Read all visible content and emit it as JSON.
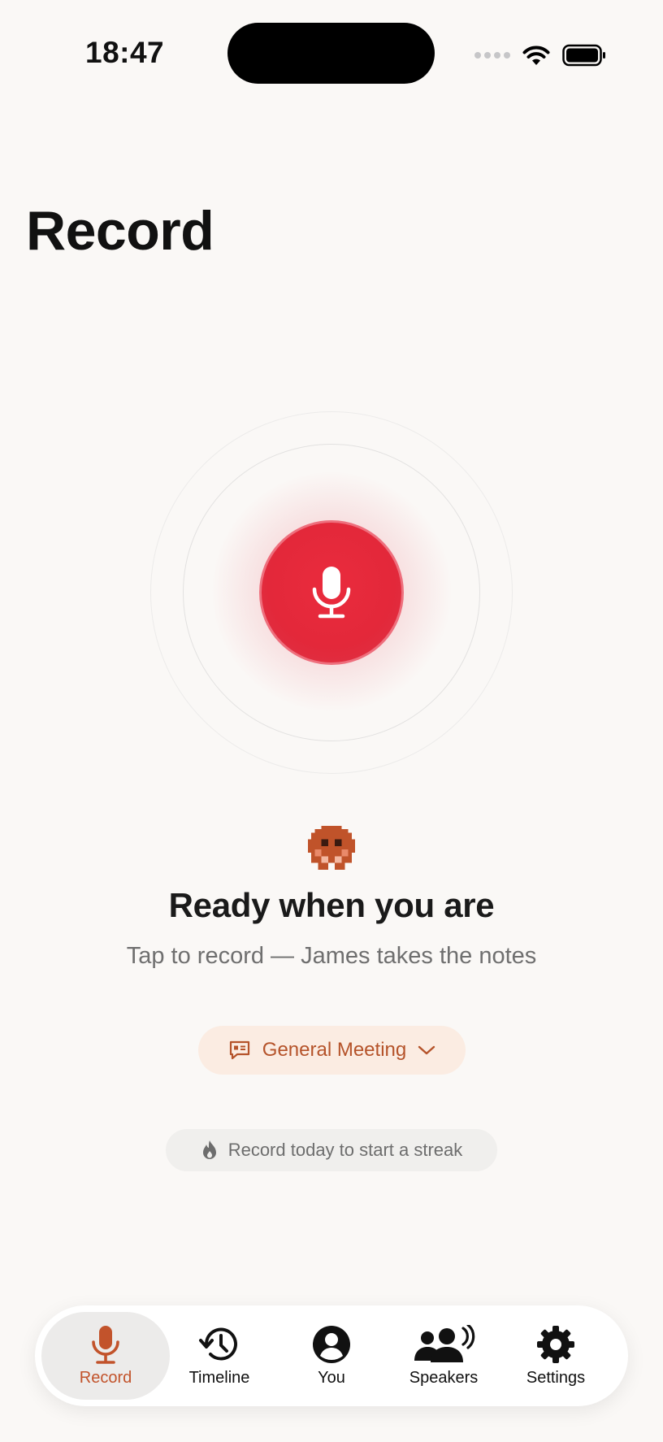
{
  "status_bar": {
    "time": "18:47"
  },
  "page": {
    "title": "Record"
  },
  "prompt": {
    "title": "Ready when you are",
    "subtitle": "Tap to record — James takes the notes"
  },
  "meeting_type": {
    "label": "General Meeting",
    "icon": "chat-board-icon"
  },
  "streak": {
    "label": "Record today to start a streak",
    "icon": "flame-icon"
  },
  "tabs": [
    {
      "label": "Record",
      "icon": "microphone-icon",
      "active": true
    },
    {
      "label": "Timeline",
      "icon": "history-icon",
      "active": false
    },
    {
      "label": "You",
      "icon": "person-icon",
      "active": false
    },
    {
      "label": "Speakers",
      "icon": "speakers-icon",
      "active": false
    },
    {
      "label": "Settings",
      "icon": "gear-icon",
      "active": false
    }
  ],
  "colors": {
    "accent": "#c2532b",
    "record_red": "#e3283a",
    "background": "#faf8f6"
  }
}
